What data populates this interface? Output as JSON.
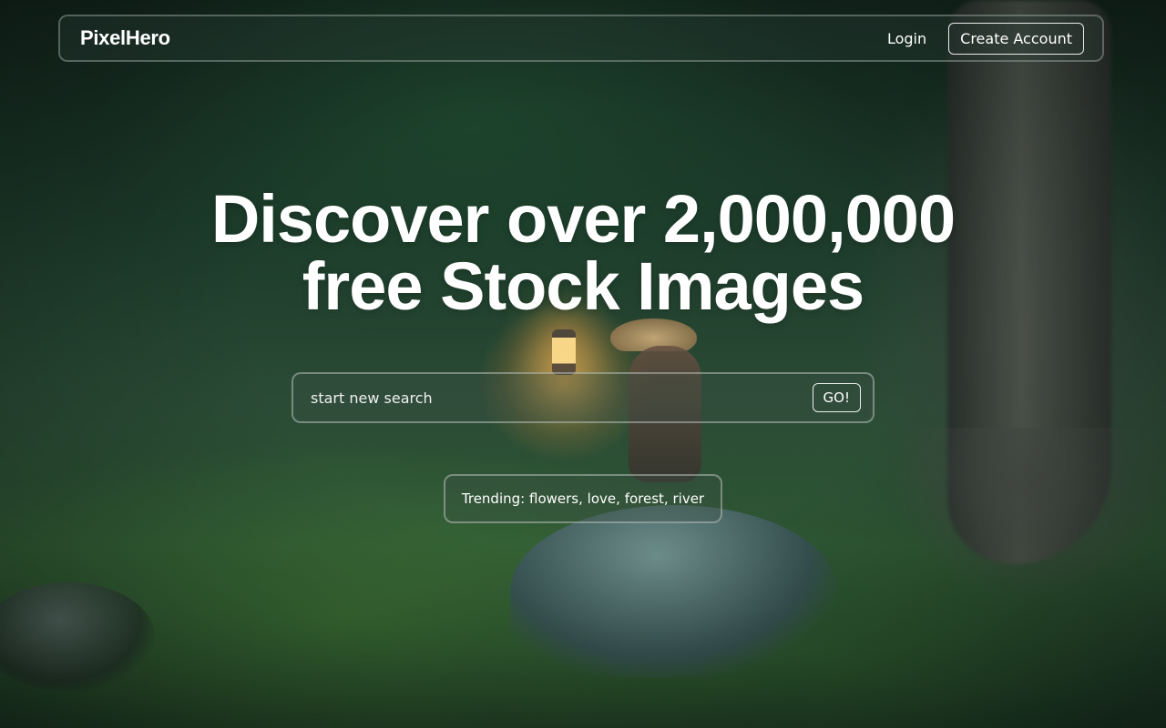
{
  "brand": {
    "name": "PixelHero"
  },
  "nav": {
    "login_label": "Login",
    "create_account_label": "Create Account"
  },
  "hero": {
    "headline_line1": "Discover over 2,000,000",
    "headline_line2": "free Stock Images"
  },
  "search": {
    "placeholder": "start new search",
    "value": "",
    "go_label": "GO!"
  },
  "trending": {
    "prefix": "Trending:",
    "tags": [
      "flowers",
      "love",
      "forest",
      "river"
    ],
    "separator": ","
  },
  "colors": {
    "text": "#ffffff",
    "overlay_border": "#d2d7d2",
    "background_dark": "#1d2b22"
  },
  "background": {
    "description_icon": "photo-background"
  }
}
